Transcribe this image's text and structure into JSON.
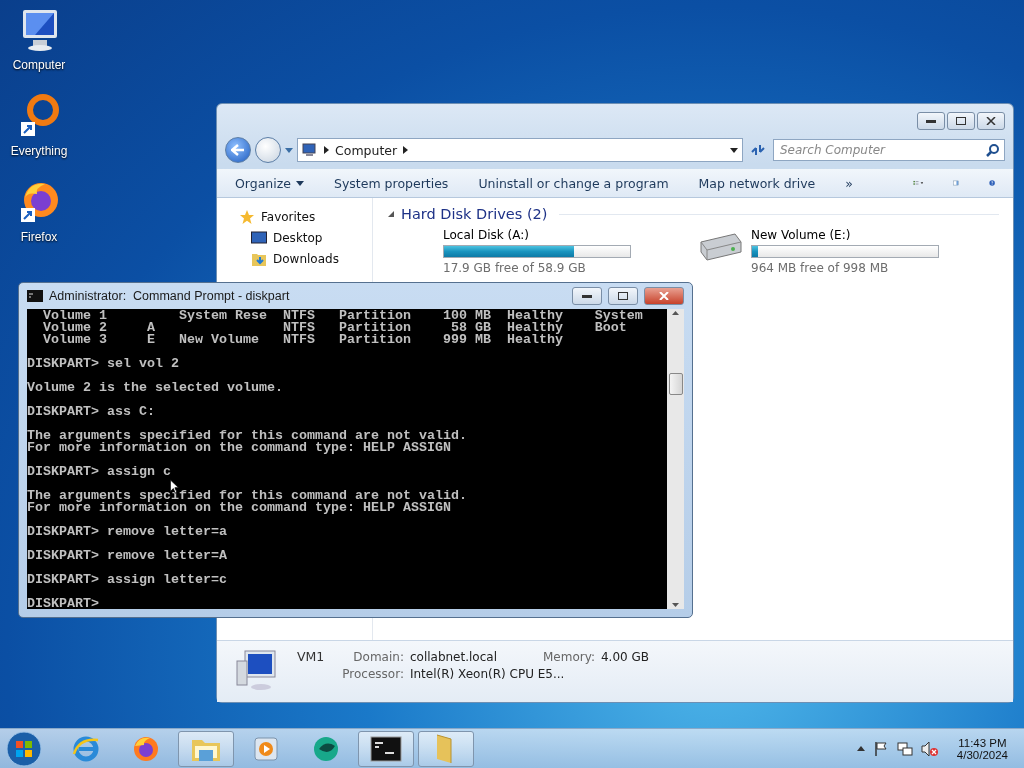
{
  "desktop_icons": [
    {
      "label": "Computer",
      "kind": "computer"
    },
    {
      "label": "Everything",
      "kind": "everything"
    },
    {
      "label": "Firefox",
      "kind": "firefox"
    }
  ],
  "explorer": {
    "address": [
      "Computer"
    ],
    "search": {
      "placeholder": "Search Computer"
    },
    "toolbar": [
      {
        "label": "Organize",
        "menu": true
      },
      {
        "label": "System properties",
        "menu": false
      },
      {
        "label": "Uninstall or change a program",
        "menu": false
      },
      {
        "label": "Map network drive",
        "menu": false
      }
    ],
    "more": "»",
    "nav": [
      {
        "label": "Favorites",
        "kind": "star"
      },
      {
        "label": "Desktop",
        "kind": "desktop"
      },
      {
        "label": "Downloads",
        "kind": "downloads"
      }
    ],
    "group": {
      "title": "Hard Disk Drives (2)",
      "expanded": true
    },
    "drives": [
      {
        "name": "Local Disk (A:)",
        "level": 0.7,
        "free": "17.9 GB free of 58.9 GB",
        "icon_visible": false
      },
      {
        "name": "New Volume (E:)",
        "level": 0.03,
        "free": "964 MB free of 998 MB",
        "icon_visible": true
      }
    ],
    "details": {
      "name": "VM1",
      "fields": [
        {
          "label": "Domain:",
          "value": "collabnet.local"
        },
        {
          "label": "Memory:",
          "value": "4.00 GB"
        },
        {
          "label": "Processor:",
          "value": "Intel(R) Xeon(R) CPU E5..."
        }
      ]
    }
  },
  "console": {
    "title": "Administrator:  Command Prompt - diskpart",
    "blocks": [
      [
        "  Volume 1         System Rese  NTFS   Partition    100 MB  Healthy    System",
        "  Volume 2     A                NTFS   Partition     58 GB  Healthy    Boot",
        "  Volume 3     E   New Volume   NTFS   Partition    999 MB  Healthy"
      ],
      [
        "DISKPART> sel vol 2"
      ],
      [
        "Volume 2 is the selected volume."
      ],
      [
        "DISKPART> ass C:"
      ],
      [
        "The arguments specified for this command are not valid.",
        "For more information on the command type: HELP ASSIGN"
      ],
      [
        "DISKPART> assign c"
      ],
      [
        "The arguments specified for this command are not valid.",
        "For more information on the command type: HELP ASSIGN"
      ],
      [
        "DISKPART> remove letter=a"
      ],
      [
        "DISKPART> remove letter=A"
      ],
      [
        "DISKPART> assign letter=c"
      ],
      [
        "DISKPART>"
      ]
    ]
  },
  "taskbar": {
    "apps": [
      {
        "kind": "ie",
        "running": false
      },
      {
        "kind": "firefox",
        "running": false
      },
      {
        "kind": "explorer",
        "running": true
      },
      {
        "kind": "media",
        "running": false
      },
      {
        "kind": "green",
        "running": false
      },
      {
        "kind": "cmd",
        "running": true
      },
      {
        "kind": "folder",
        "running": true
      }
    ],
    "clock": {
      "time": "11:43 PM",
      "date": "4/30/2024"
    }
  }
}
